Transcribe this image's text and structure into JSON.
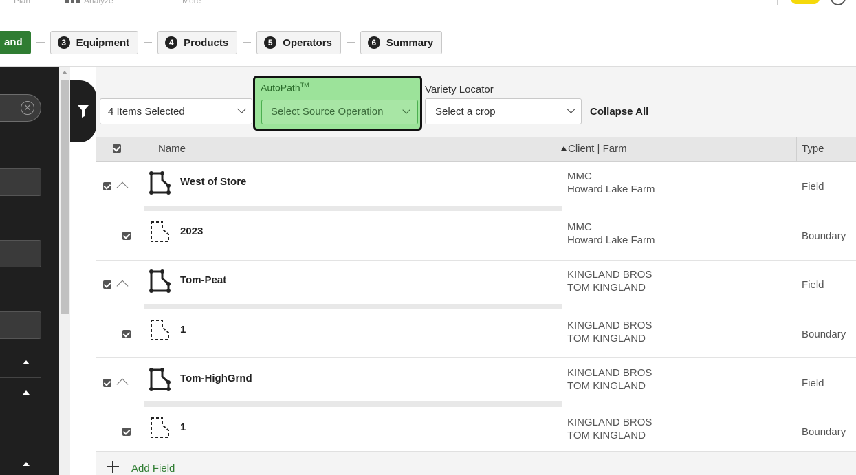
{
  "top_nav": {
    "item1": "Plan",
    "item2": "Analyze",
    "item3": "More"
  },
  "wizard": {
    "active_step": "and",
    "steps": [
      {
        "num": "3",
        "label": "Equipment"
      },
      {
        "num": "4",
        "label": "Products"
      },
      {
        "num": "5",
        "label": "Operators"
      },
      {
        "num": "6",
        "label": "Summary"
      }
    ]
  },
  "toolbar": {
    "items_selected": "4 Items Selected",
    "autopath_label": "AutoPath",
    "autopath_sup": "TM",
    "autopath_placeholder": "Select Source Operation",
    "variety_label": "Variety Locator",
    "variety_placeholder": "Select a crop",
    "collapse_all": "Collapse All"
  },
  "table": {
    "headers": {
      "name": "Name",
      "client_farm": "Client | Farm",
      "type": "Type"
    },
    "rows": [
      {
        "kind": "field",
        "name": "West of Store",
        "client": "MMC",
        "farm": "Howard Lake Farm",
        "type": "Field"
      },
      {
        "kind": "boundary",
        "name": "2023",
        "client": "MMC",
        "farm": "Howard Lake Farm",
        "type": "Boundary"
      },
      {
        "kind": "field",
        "name": "Tom-Peat",
        "client": "KINGLAND BROS",
        "farm": "TOM KINGLAND",
        "type": "Field"
      },
      {
        "kind": "boundary",
        "name": "1",
        "client": "KINGLAND BROS",
        "farm": "TOM KINGLAND",
        "type": "Boundary"
      },
      {
        "kind": "field",
        "name": "Tom-HighGrnd",
        "client": "KINGLAND BROS",
        "farm": "TOM KINGLAND",
        "type": "Field"
      },
      {
        "kind": "boundary",
        "name": "1",
        "client": "KINGLAND BROS",
        "farm": "TOM KINGLAND",
        "type": "Boundary"
      }
    ],
    "add_field": "Add Field"
  },
  "colors": {
    "accent_green": "#2f7d32",
    "highlight_green": "#9ce39a",
    "sidebar": "#1f1f1f"
  }
}
